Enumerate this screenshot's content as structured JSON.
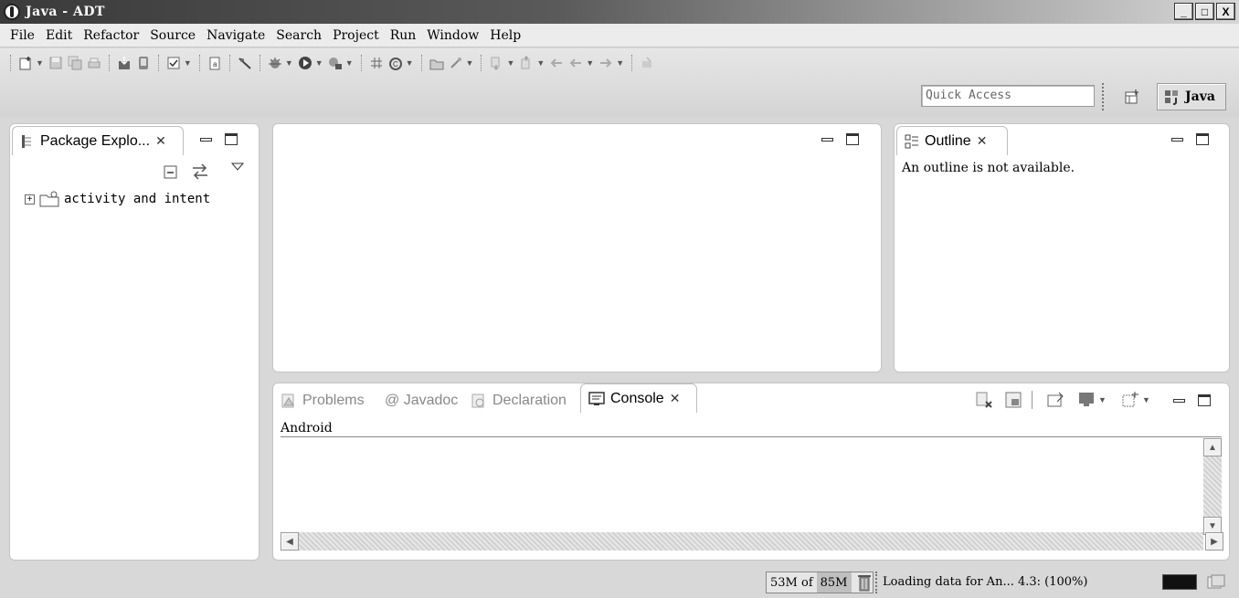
{
  "window": {
    "title": "Java - ADT",
    "buttons": {
      "minimize": "_",
      "maximize": "□",
      "close": "X"
    }
  },
  "menu": [
    "File",
    "Edit",
    "Refactor",
    "Source",
    "Navigate",
    "Search",
    "Project",
    "Run",
    "Window",
    "Help"
  ],
  "toolbar": {
    "quick_access_placeholder": "Quick Access",
    "perspective_label": "Java"
  },
  "package_explorer": {
    "tab_label": "Package Explo...",
    "tree": [
      {
        "label": "activity and intent",
        "expander": "+"
      }
    ]
  },
  "outline": {
    "tab_label": "Outline",
    "message": "An outline is not available."
  },
  "bottom_panel": {
    "tabs": [
      "Problems",
      "@ Javadoc",
      "Declaration",
      "Console"
    ],
    "active_tab": "Console",
    "console_label": "Android"
  },
  "status": {
    "heap_used": "53M",
    "heap_of": "of",
    "heap_total": "85M",
    "message": "Loading data for An... 4.3: (100%)"
  },
  "colors": {
    "background": "#d8d8d8",
    "panel": "#ffffff",
    "titlebar_dark": "#3a3a3a"
  }
}
